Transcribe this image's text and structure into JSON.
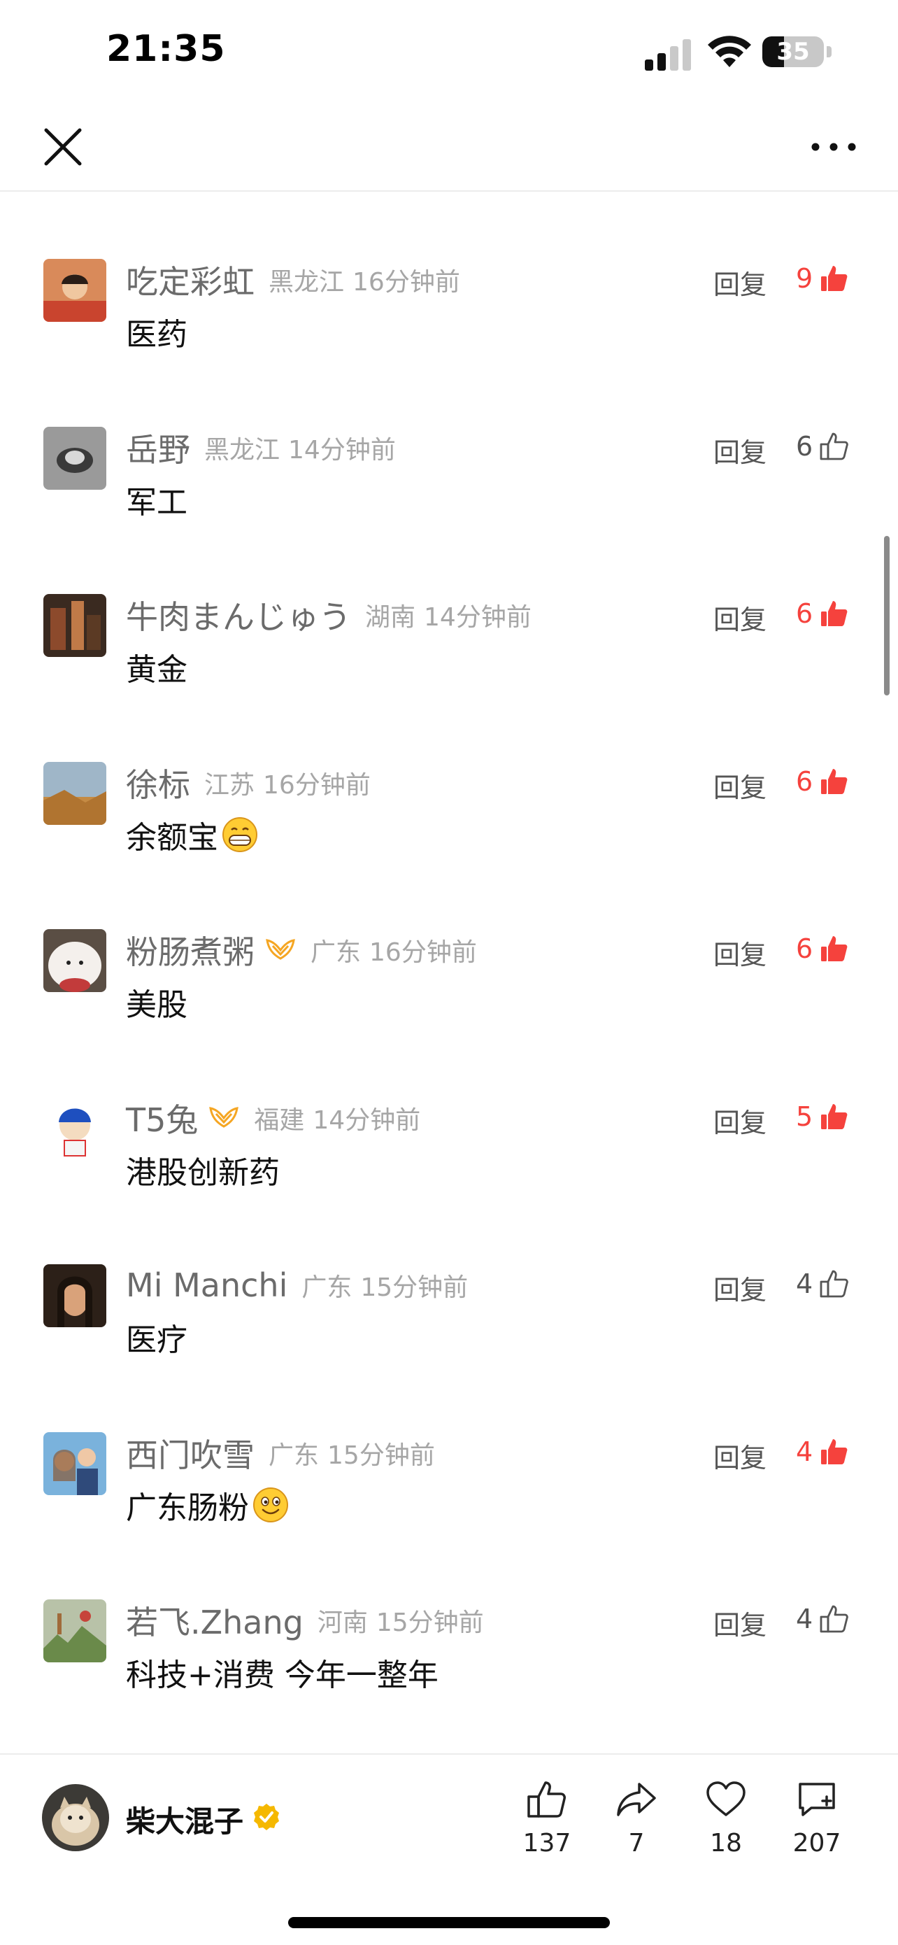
{
  "status_bar": {
    "time": "21:35",
    "battery_level": "35"
  },
  "nav": {
    "close_icon": "close-icon",
    "more_icon": "more-icon"
  },
  "comments": [
    {
      "name": "吃定彩虹",
      "region": "黑龙江",
      "time": "16分钟前",
      "text": "医药",
      "reply": "回复",
      "likes": "9",
      "liked": true,
      "vip": false,
      "emoji": ""
    },
    {
      "name": "岳野",
      "region": "黑龙江",
      "time": "14分钟前",
      "text": "军工",
      "reply": "回复",
      "likes": "6",
      "liked": false,
      "vip": false,
      "emoji": ""
    },
    {
      "name": "牛肉まんじゅう",
      "region": "湖南",
      "time": "14分钟前",
      "text": "黄金",
      "reply": "回复",
      "likes": "6",
      "liked": true,
      "vip": false,
      "emoji": ""
    },
    {
      "name": "徐标",
      "region": "江苏",
      "time": "16分钟前",
      "text": "余额宝",
      "reply": "回复",
      "likes": "6",
      "liked": true,
      "vip": false,
      "emoji": "grin-emoji"
    },
    {
      "name": "粉肠煮粥",
      "region": "广东",
      "time": "16分钟前",
      "text": "美股",
      "reply": "回复",
      "likes": "6",
      "liked": true,
      "vip": true,
      "emoji": ""
    },
    {
      "name": "T5兔",
      "region": "福建",
      "time": "14分钟前",
      "text": "港股创新药",
      "reply": "回复",
      "likes": "5",
      "liked": true,
      "vip": true,
      "emoji": ""
    },
    {
      "name": "Mi Manchi",
      "region": "广东",
      "time": "15分钟前",
      "text": "医疗",
      "reply": "回复",
      "likes": "4",
      "liked": false,
      "vip": false,
      "emoji": ""
    },
    {
      "name": "西门吹雪",
      "region": "广东",
      "time": "15分钟前",
      "text": "广东肠粉",
      "reply": "回复",
      "likes": "4",
      "liked": true,
      "vip": false,
      "emoji": "smile-emoji"
    },
    {
      "name": "若飞.Zhang",
      "region": "河南",
      "time": "15分钟前",
      "text": "科技+消费 今年一整年",
      "reply": "回复",
      "likes": "4",
      "liked": false,
      "vip": false,
      "emoji": ""
    }
  ],
  "bottom_bar": {
    "author": "柴大混子",
    "likes": "137",
    "shares": "7",
    "favorites": "18",
    "comments": "207"
  },
  "colors": {
    "liked": "#f5423d",
    "vip": "#f5a623",
    "verified": "#f5b800"
  }
}
